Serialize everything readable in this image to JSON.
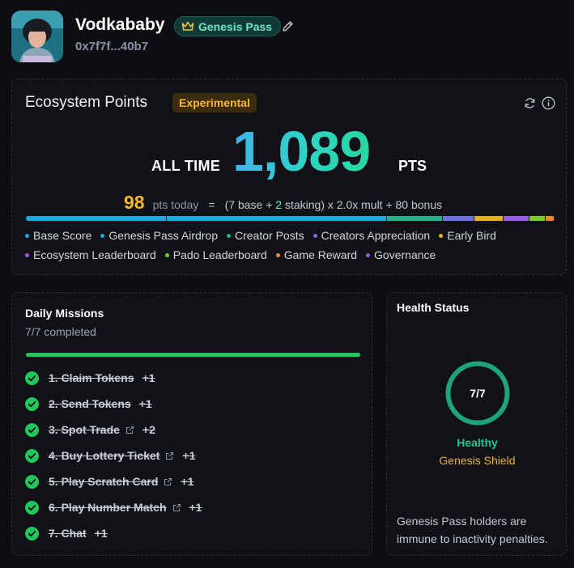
{
  "profile": {
    "username": "Vodkababy",
    "pass_badge": "Genesis Pass",
    "address": "0x7f7f...40b7"
  },
  "ecosystem": {
    "title": "Ecosystem Points",
    "badge": "Experimental",
    "all_time_label": "ALL TIME",
    "total_points": "1,089",
    "pts_label": "PTS",
    "today_value": "98",
    "today_label": "pts today",
    "equals": "=",
    "formula": {
      "open": "(",
      "base_value": "7",
      "base_text": " base + ",
      "staking_value": "2",
      "staking_text": " staking) x 2.0x mult + 80 bonus"
    },
    "breakdown": [
      {
        "name": "Base Score",
        "color": "#1ba9e0",
        "share": 0.265
      },
      {
        "name": "Genesis Pass Airdrop",
        "color": "#1ba9e0",
        "share": 0.418
      },
      {
        "name": "Creator Posts",
        "color": "#1fb28a",
        "share": 0.105
      },
      {
        "name": "Creators Appreciation",
        "color": "#6f6fe8",
        "share": 0.06
      },
      {
        "name": "Early Bird",
        "color": "#e8b020",
        "share": 0.056
      },
      {
        "name": "Ecosystem Leaderboard",
        "color": "#9a5ce6",
        "share": 0.048
      },
      {
        "name": "Pado Leaderboard",
        "color": "#7ccd2a",
        "share": 0.031
      },
      {
        "name": "Game Reward",
        "color": "#f08a24",
        "share": 0.017
      },
      {
        "name": "Governance",
        "color": "#9a5ce6",
        "share": 0
      }
    ],
    "legend": [
      {
        "label": "Base Score",
        "color": "#1ba9e0"
      },
      {
        "label": "Genesis Pass Airdrop",
        "color": "#1ba9e0"
      },
      {
        "label": "Creator Posts",
        "color": "#1fb28a"
      },
      {
        "label": "Creators Appreciation",
        "color": "#6f6fe8"
      },
      {
        "label": "Early Bird",
        "color": "#e8b020"
      },
      {
        "label": "Ecosystem Leaderboard",
        "color": "#9a5ce6"
      },
      {
        "label": "Pado Leaderboard",
        "color": "#7ccd2a"
      },
      {
        "label": "Game Reward",
        "color": "#f08a24"
      },
      {
        "label": "Governance",
        "color": "#9a5ce6"
      }
    ]
  },
  "missions": {
    "title": "Daily Missions",
    "completed_text": "7/7 completed",
    "progress": 1.0,
    "items": [
      {
        "name": "1. Claim Tokens",
        "reward": "+1",
        "external": false
      },
      {
        "name": "2. Send Tokens",
        "reward": "+1",
        "external": false
      },
      {
        "name": "3. Spot Trade",
        "reward": "+2",
        "external": true
      },
      {
        "name": "4. Buy Lottery Ticket",
        "reward": "+1",
        "external": true
      },
      {
        "name": "5. Play Scratch Card",
        "reward": "+1",
        "external": true
      },
      {
        "name": "6. Play Number Match",
        "reward": "+1",
        "external": true
      },
      {
        "name": "7. Chat",
        "reward": "+1",
        "external": false
      }
    ]
  },
  "health": {
    "title": "Health Status",
    "score": "7/7",
    "fraction": 1.0,
    "status": "Healthy",
    "shield": "Genesis Shield",
    "note": "Genesis Pass holders are immune to inactivity penalties.",
    "ring_color": "#1fa37a"
  }
}
